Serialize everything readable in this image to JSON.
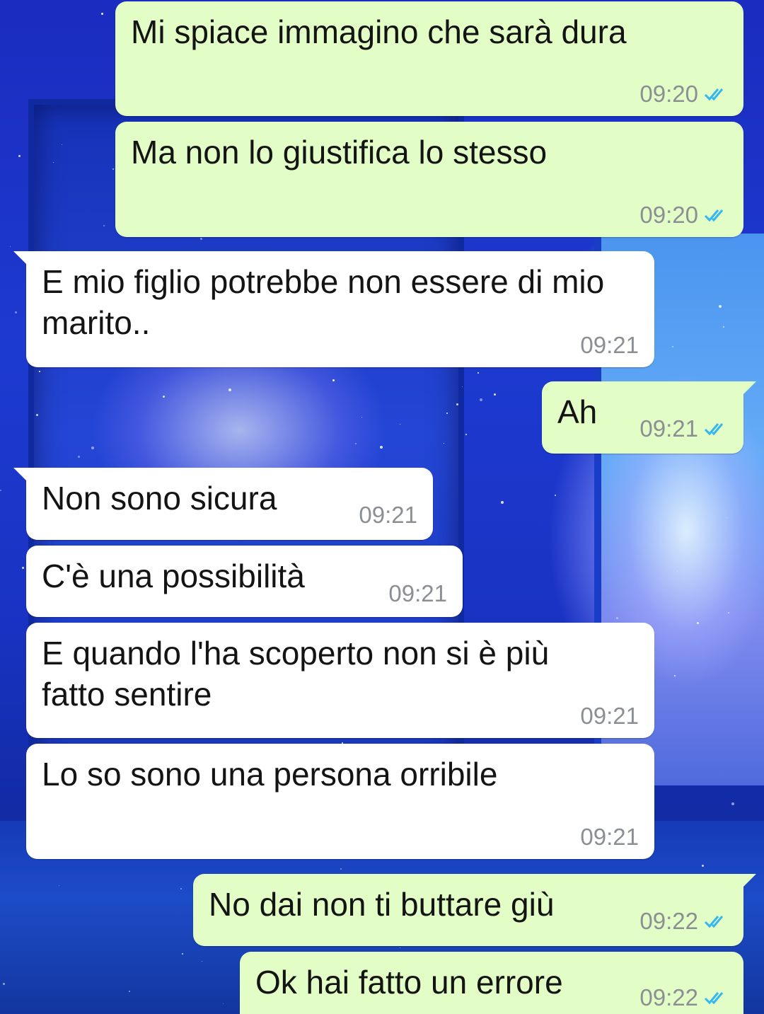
{
  "conversation": {
    "messages": [
      {
        "direction": "outgoing",
        "text": "Mi spiace immagino che sarà dura",
        "time": "09:20",
        "status_icon": "double-check-read-icon"
      },
      {
        "direction": "outgoing",
        "text": "Ma non lo giustifica lo stesso",
        "time": "09:20",
        "status_icon": "double-check-read-icon"
      },
      {
        "direction": "incoming",
        "text": "E mio figlio potrebbe non essere di mio marito..",
        "time": "09:21"
      },
      {
        "direction": "outgoing",
        "text": "Ah",
        "time": "09:21",
        "status_icon": "double-check-read-icon"
      },
      {
        "direction": "incoming",
        "text": "Non sono sicura",
        "time": "09:21"
      },
      {
        "direction": "incoming",
        "text": "C'è una possibilità",
        "time": "09:21"
      },
      {
        "direction": "incoming",
        "text": "E quando l'ha scoperto non si è più fatto sentire",
        "time": "09:21"
      },
      {
        "direction": "incoming",
        "text": "Lo so sono una persona orribile",
        "time": "09:21"
      },
      {
        "direction": "outgoing",
        "text": "No dai non ti buttare giù",
        "time": "09:22",
        "status_icon": "double-check-read-icon"
      },
      {
        "direction": "outgoing",
        "text": "Ok hai fatto un errore",
        "time": "09:22",
        "status_icon": "double-check-read-icon"
      }
    ]
  },
  "colors": {
    "outgoing_bubble": "#e2fec6",
    "incoming_bubble": "#ffffff",
    "read_ticks": "#34b7f1",
    "timestamp": "#8b8f93",
    "wallpaper_base": "#1d3ad0"
  }
}
